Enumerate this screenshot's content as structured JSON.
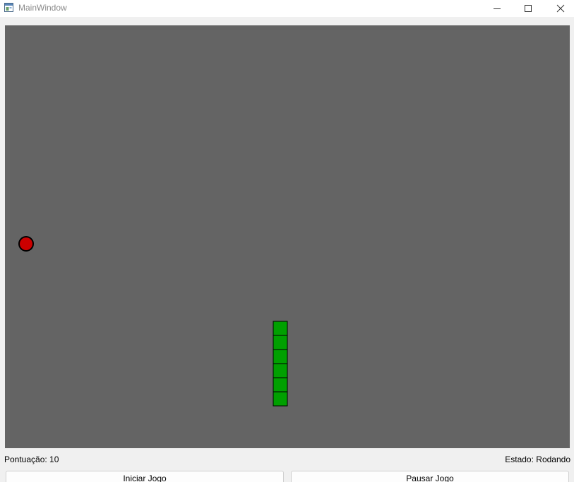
{
  "window": {
    "title": "MainWindow"
  },
  "game": {
    "background_color": "#646464",
    "food_color": "#cc0000",
    "snake_color": "#00a000",
    "snake_segments": 6
  },
  "status": {
    "score_label": "Pontuação: 10",
    "state_label": "Estado: Rodando"
  },
  "buttons": {
    "start_label": "Iniciar Jogo",
    "pause_label": "Pausar Jogo"
  }
}
